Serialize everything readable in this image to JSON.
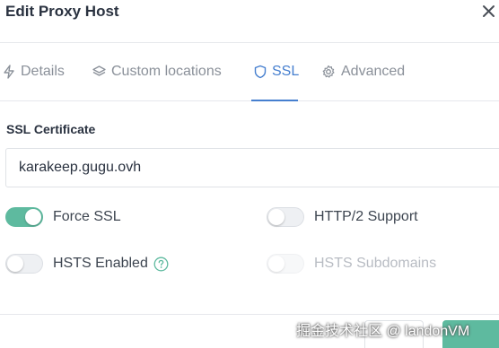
{
  "modal": {
    "title": "Edit Proxy Host"
  },
  "tabs": [
    {
      "label": "Details",
      "icon": "bolt-icon",
      "active": false
    },
    {
      "label": "Custom locations",
      "icon": "layers-icon",
      "active": false
    },
    {
      "label": "SSL",
      "icon": "shield-icon",
      "active": true
    },
    {
      "label": "Advanced",
      "icon": "gear-icon",
      "active": false
    }
  ],
  "ssl": {
    "certificate_label": "SSL Certificate",
    "certificate_value": "karakeep.gugu.ovh",
    "toggles": [
      {
        "label": "Force SSL",
        "on": true,
        "disabled": false
      },
      {
        "label": "HTTP/2 Support",
        "on": false,
        "disabled": false
      },
      {
        "label": "HSTS Enabled",
        "on": false,
        "disabled": false,
        "help_icon": "question-circle-icon"
      },
      {
        "label": "HSTS Subdomains",
        "on": false,
        "disabled": true
      }
    ]
  },
  "watermark": "掘金技术社区 @ landonVM",
  "colors": {
    "accent": "#467fcf",
    "toggle_on": "#5eba9f",
    "save_button": "#5eba9f"
  }
}
